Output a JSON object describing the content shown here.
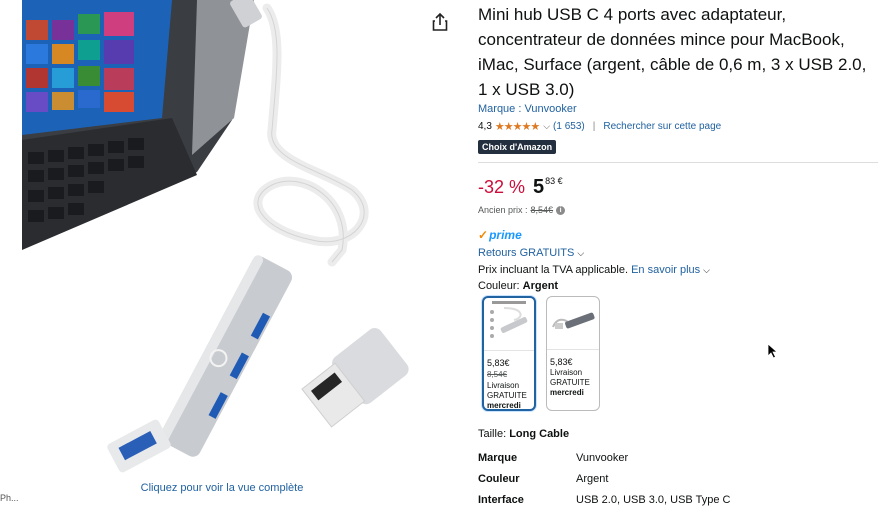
{
  "gallery": {
    "view_full_label": "Cliquez pour voir la vue complète"
  },
  "product": {
    "title": "Mini hub USB C 4 ports avec adaptateur, concentrateur de données mince pour MacBook, iMac, Surface (argent, câble de 0,6 m, 3 x USB 2.0, 1 x USB 3.0)",
    "brand_link": "Marque : Vunvooker",
    "rating_value": "4,3",
    "rating_stars": "★★★★★",
    "rating_count": "(1 653)",
    "search_page_link": "Rechercher sur cette page",
    "badge": "Choix d'Amazon"
  },
  "pricing": {
    "discount": "-32 %",
    "price_whole": "5",
    "price_fraction_currency": "83 €",
    "old_price_label": "Ancien prix :",
    "old_price": "8,54€",
    "info_glyph": "i"
  },
  "delivery": {
    "prime_check": "✓",
    "prime_label": "prime",
    "returns_label": "Retours GRATUITS",
    "tva_text": "Prix incluant la TVA applicable.",
    "tva_link": "En savoir plus"
  },
  "color": {
    "label": "Couleur:",
    "value": "Argent",
    "options": [
      {
        "price": "5,83€",
        "old_price": "8,54€",
        "ship_line1": "Livraison",
        "ship_line2": "GRATUITE",
        "ship_line3": "mercredi",
        "selected": true
      },
      {
        "price": "5,83€",
        "old_price": "",
        "ship_line1": "Livraison",
        "ship_line2": "GRATUITE",
        "ship_line3": "mercredi",
        "selected": false
      }
    ]
  },
  "size": {
    "label": "Taille:",
    "value": "Long Cable"
  },
  "specs": [
    {
      "key": "Marque",
      "value": "Vunvooker"
    },
    {
      "key": "Couleur",
      "value": "Argent"
    },
    {
      "key": "Interface",
      "value": "USB 2.0, USB 3.0, USB Type C"
    }
  ],
  "misc": {
    "bottom_left_fragment": "Ph..."
  },
  "colors": {
    "link": "#2162a1",
    "discount": "#cc0c39",
    "star": "#de7921",
    "badge_bg": "#232f3e",
    "prime": "#1a98ff"
  },
  "icons": {
    "share": "share-icon",
    "cursor": "mouse-pointer-icon",
    "info": "info-icon",
    "chevron": "chevron-down-icon"
  }
}
